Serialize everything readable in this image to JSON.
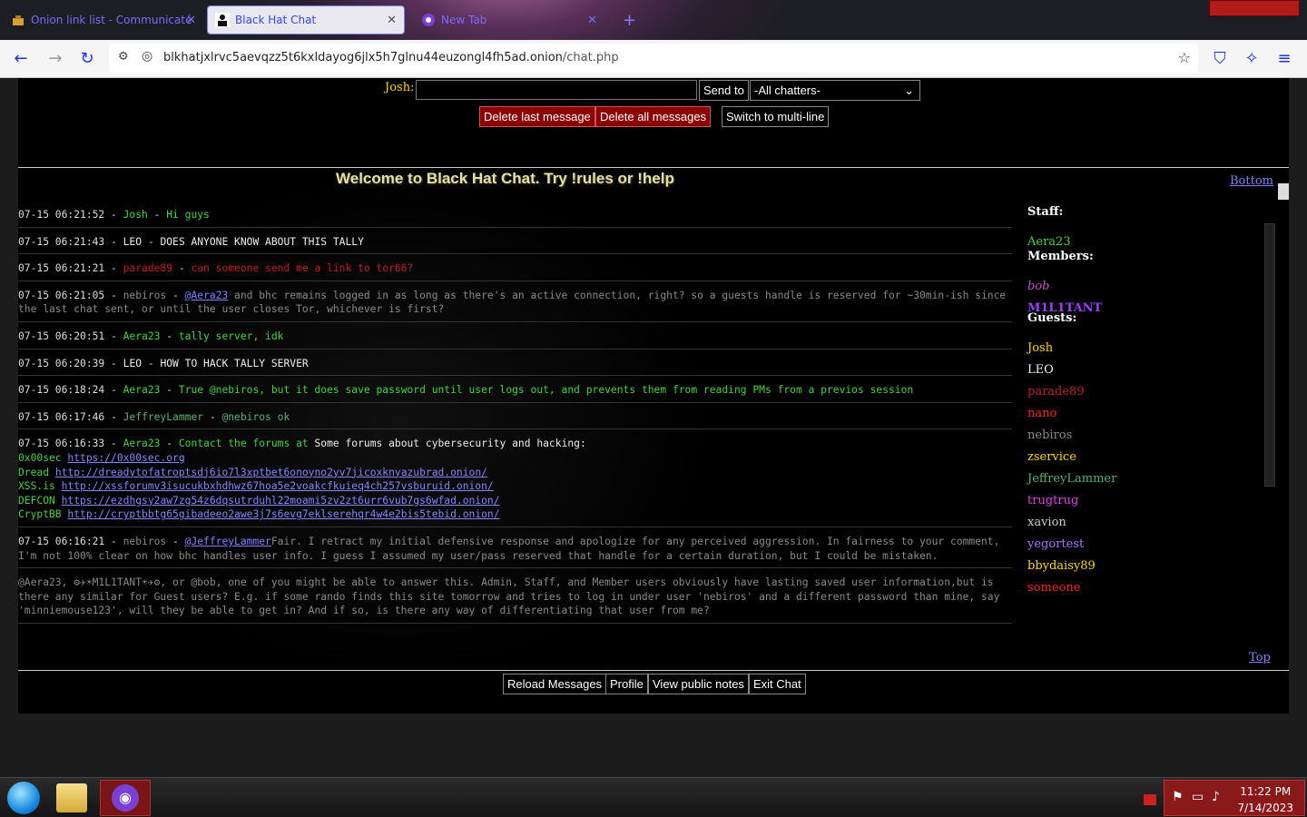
{
  "browser": {
    "tabs": [
      {
        "label": "Onion link list - Communicaté",
        "active": false
      },
      {
        "label": "Black Hat Chat",
        "active": true
      },
      {
        "label": "New Tab",
        "active": false
      }
    ],
    "url_host": "blkhatjxlrvc5aevqzz5t6kxldayog6jlx5h7glnu44euzongl4fh5ad.onion",
    "url_path": "/chat.php"
  },
  "form": {
    "name_label": "Josh:",
    "message_value": "",
    "send_to_label": "Send to",
    "recipient_selected": "-All chatters-",
    "delete_last_label": "Delete last message",
    "delete_all_label": "Delete all messages",
    "multiline_label": "Switch to multi-line"
  },
  "welcome": "Welcome to Black Hat Chat. Try !rules or !help",
  "bottom_link": "Bottom",
  "top_link": "Top",
  "messages": [
    {
      "ts": "07-15 06:21:52",
      "user": "Josh",
      "text": "Hi guys",
      "color": "#3fd43f"
    },
    {
      "ts": "07-15 06:21:43",
      "user": "LEO",
      "text": "DOES ANYONE KNOW ABOUT THIS TALLY",
      "color": "#eeeeee"
    },
    {
      "ts": "07-15 06:21:21",
      "user": "parade89",
      "text": "can someone send me a link to tor66?",
      "color": "#c02020"
    },
    {
      "ts": "07-15 06:21:05",
      "user": "nebiros",
      "mention": "@Aera23",
      "text": " and bhc remains logged in as long as there's an active connection, right? so a guests handle is reserved for ~30min-ish since the last chat sent, or until the user closes Tor, whichever is first?",
      "color": "#8a8a8a"
    },
    {
      "ts": "07-15 06:20:51",
      "user": "Aera23",
      "text": "tally server, idk",
      "color": "#3fd43f"
    },
    {
      "ts": "07-15 06:20:39",
      "user": "LEO",
      "text": "HOW TO HACK TALLY SERVER",
      "color": "#eeeeee"
    },
    {
      "ts": "07-15 06:18:24",
      "user": "Aera23",
      "text": "True @nebiros, but it does save password until user logs out, and prevents them from reading PMs from a previos session",
      "color": "#3fd43f"
    },
    {
      "ts": "07-15 06:17:46",
      "user": "JeffreyLammer",
      "text": "@nebiros ok",
      "color": "#56b06a"
    },
    {
      "ts": "07-15 06:16:33",
      "user": "Aera23",
      "text": "Contact the forums at",
      "extra": "Some forums about cybersecurity and hacking:",
      "links": [
        {
          "name": "0x00sec",
          "url": "https://0x00sec.org"
        },
        {
          "name": "Dread",
          "url": "http://dreadytofatroptsdj6io7l3xptbet6onoyno2yv7jicoxknyazubrad.onion/"
        },
        {
          "name": "XSS.is",
          "url": "http://xssforumv3isucukbxhdhwz67hoa5e2voakcfkuieq4ch257vsburuid.onion/"
        },
        {
          "name": "DEFCON",
          "url": "https://ezdhgsy2aw7zg54z6dqsutrduhl22moami5zv2zt6urr6vub7gs6wfad.onion/"
        },
        {
          "name": "CryptBB",
          "url": "http://cryptbbtg65gibadeeo2awe3j7s6evg7eklserehqr4w4e2bis5tebid.onion/"
        }
      ],
      "color": "#3fd43f"
    },
    {
      "ts": "07-15 06:16:21",
      "user": "nebiros",
      "mention": "@JeffreyLammer",
      "text": "Fair. I retract my initial defensive response and apologize for any perceived aggression. In fairness to your comment, I'm not 100% clear on how bhc handles user info. I guess I assumed my user/pass reserved that handle for a certain duration, but I could be mistaken.",
      "color": "#8a8a8a"
    },
    {
      "ts": "",
      "user": "",
      "text": "@Aera23, ⚙✈☀M1L1TANT☀✈⚙, or @bob, one of you might be able to answer this. Admin, Staff, and Member users obviously have lasting saved user information,but is there any similar for Guest users? E.g. if some rando finds this site tomorrow and tries to log in under user 'nebiros' and a different password than mine, say 'minniemouse123', will they be able to get in? And if so, is there any way of differentiating that user from me?",
      "color": "#8a8a8a"
    }
  ],
  "sidebar": {
    "staff_label": "Staff:",
    "staff": [
      {
        "name": "Aera23",
        "color": "#3fd43f"
      }
    ],
    "members_label": "Members:",
    "members": [
      {
        "name": "bob",
        "color": "#c54dc5"
      },
      {
        "name": "M1L1TANT",
        "color": "#9c3dff"
      }
    ],
    "guests_label": "Guests:",
    "guests": [
      {
        "name": "Josh",
        "color": "#ffd700"
      },
      {
        "name": "LEO",
        "color": "#eeeeee"
      },
      {
        "name": "parade89",
        "color": "#c02020"
      },
      {
        "name": "nano",
        "color": "#ff2020"
      },
      {
        "name": "nebiros",
        "color": "#8a8a8a"
      },
      {
        "name": "zservice",
        "color": "#ffd700"
      },
      {
        "name": "JeffreyLammer",
        "color": "#56b06a"
      },
      {
        "name": "trugtrug",
        "color": "#e040e0"
      },
      {
        "name": "xavion",
        "color": "#cccccc"
      },
      {
        "name": "yegortest",
        "color": "#b070ff"
      },
      {
        "name": "bbydaisy89",
        "color": "#ffd700"
      },
      {
        "name": "someone",
        "color": "#ff2020"
      }
    ]
  },
  "footer": {
    "reload_label": "Reload Messages",
    "profile_label": "Profile",
    "notes_label": "View public notes",
    "exit_label": "Exit Chat"
  },
  "taskbar": {
    "time": "11:22 PM",
    "date": "7/14/2023"
  }
}
